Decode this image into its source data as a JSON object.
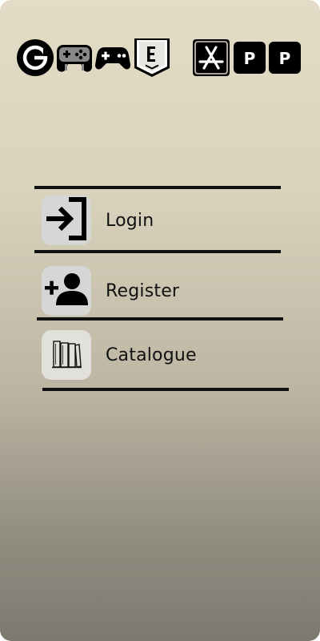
{
  "header_icons": [
    {
      "name": "g-logo-icon"
    },
    {
      "name": "gamepad-icon"
    },
    {
      "name": "game-controller-icon"
    },
    {
      "name": "epic-games-icon"
    },
    {
      "name": "app-store-icon"
    },
    {
      "name": "p-badge-icon-1",
      "letter": "P"
    },
    {
      "name": "p-badge-icon-2",
      "letter": "P"
    }
  ],
  "menu": {
    "login_label": "Login",
    "register_label": "Register",
    "catalogue_label": "Catalogue"
  }
}
